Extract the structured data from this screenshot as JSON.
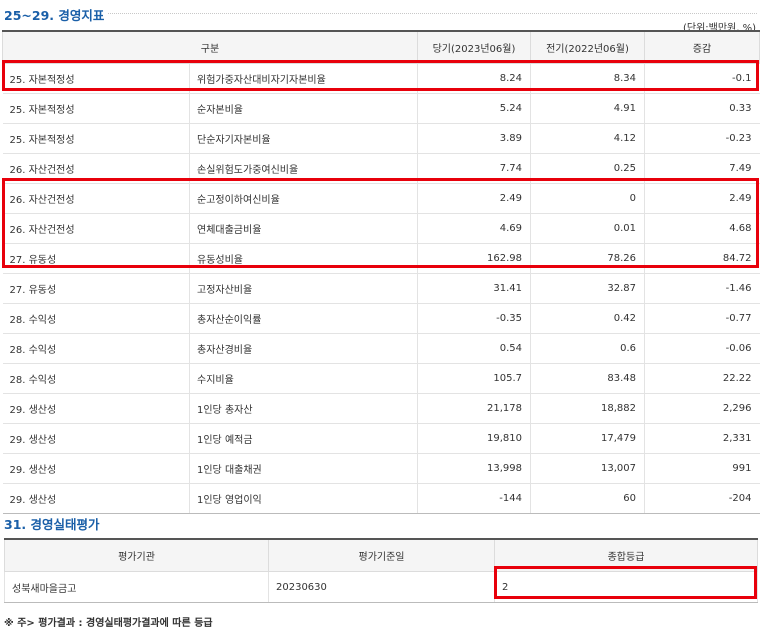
{
  "section1": {
    "title": "25~29. 경영지표",
    "unit": "(단위:백만원, %)",
    "headers": [
      "구분",
      "당기(2023년06월)",
      "전기(2022년06월)",
      "증감"
    ],
    "rows": [
      {
        "category": "25. 자본적정성",
        "indicator": "위험가중자산대비자기자본비율",
        "current": "8.24",
        "previous": "8.34",
        "change": "-0.1"
      },
      {
        "category": "25. 자본적정성",
        "indicator": "순자본비율",
        "current": "5.24",
        "previous": "4.91",
        "change": "0.33"
      },
      {
        "category": "25. 자본적정성",
        "indicator": "단순자기자본비율",
        "current": "3.89",
        "previous": "4.12",
        "change": "-0.23"
      },
      {
        "category": "26. 자산건전성",
        "indicator": "손실위험도가중여신비율",
        "current": "7.74",
        "previous": "0.25",
        "change": "7.49"
      },
      {
        "category": "26. 자산건전성",
        "indicator": "순고정이하여신비율",
        "current": "2.49",
        "previous": "0",
        "change": "2.49"
      },
      {
        "category": "26. 자산건전성",
        "indicator": "연체대출금비율",
        "current": "4.69",
        "previous": "0.01",
        "change": "4.68"
      },
      {
        "category": "27. 유동성",
        "indicator": "유동성비율",
        "current": "162.98",
        "previous": "78.26",
        "change": "84.72"
      },
      {
        "category": "27. 유동성",
        "indicator": "고정자산비율",
        "current": "31.41",
        "previous": "32.87",
        "change": "-1.46"
      },
      {
        "category": "28. 수익성",
        "indicator": "총자산순이익률",
        "current": "-0.35",
        "previous": "0.42",
        "change": "-0.77"
      },
      {
        "category": "28. 수익성",
        "indicator": "총자산경비율",
        "current": "0.54",
        "previous": "0.6",
        "change": "-0.06"
      },
      {
        "category": "28. 수익성",
        "indicator": "수지비율",
        "current": "105.7",
        "previous": "83.48",
        "change": "22.22"
      },
      {
        "category": "29. 생산성",
        "indicator": "1인당 총자산",
        "current": "21,178",
        "previous": "18,882",
        "change": "2,296"
      },
      {
        "category": "29. 생산성",
        "indicator": "1인당 예적금",
        "current": "19,810",
        "previous": "17,479",
        "change": "2,331"
      },
      {
        "category": "29. 생산성",
        "indicator": "1인당 대출채권",
        "current": "13,998",
        "previous": "13,007",
        "change": "991"
      },
      {
        "category": "29. 생산성",
        "indicator": "1인당 영업이익",
        "current": "-144",
        "previous": "60",
        "change": "-204"
      }
    ]
  },
  "section2": {
    "title": "31. 경영실태평가",
    "headers": [
      "평가기관",
      "평가기준일",
      "종합등급"
    ],
    "row": {
      "agency": "성북새마을금고",
      "date": "20230630",
      "grade": "2"
    }
  },
  "note": "※ 주> 평가결과 : 경영실태평가결과에 따른 등급",
  "colors": {
    "title": "#1a5fa8",
    "highlight": "#e8000b",
    "header_bg": "#f5f5f5"
  }
}
